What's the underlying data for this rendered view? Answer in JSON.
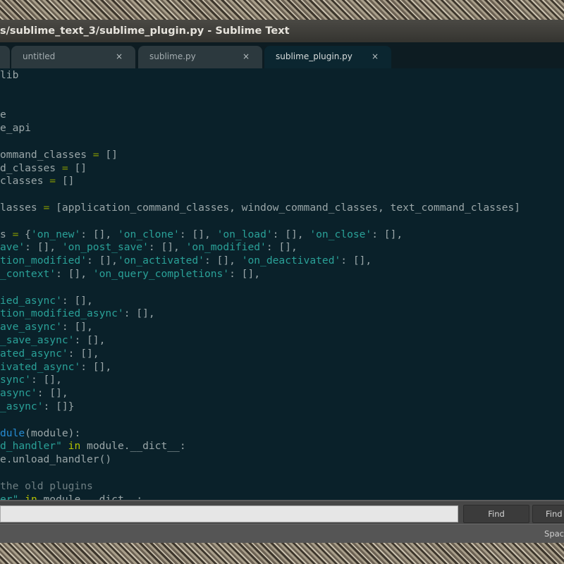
{
  "window": {
    "title": "s/sublime_text_3/sublime_plugin.py - Sublime Text"
  },
  "tabs": [
    {
      "label": "untitled",
      "close": "×",
      "active": false
    },
    {
      "label": "sublime.py",
      "close": "×",
      "active": false
    },
    {
      "label": "sublime_plugin.py",
      "close": "×",
      "active": true
    }
  ],
  "colors": {
    "editor_bg": "#0a212a",
    "string": "#2aa198",
    "operator": "#859900",
    "function": "#268bd2"
  },
  "code_lines": [
    [
      [
        "pl",
        "lib"
      ]
    ],
    [],
    [],
    [
      [
        "pl",
        "e"
      ]
    ],
    [
      [
        "pl",
        "e_api"
      ]
    ],
    [],
    [
      [
        "pl",
        "ommand_classes "
      ],
      [
        "op",
        "="
      ],
      [
        "pl",
        " []"
      ]
    ],
    [
      [
        "pl",
        "d_classes "
      ],
      [
        "op",
        "="
      ],
      [
        "pl",
        " []"
      ]
    ],
    [
      [
        "pl",
        "classes "
      ],
      [
        "op",
        "="
      ],
      [
        "pl",
        " []"
      ]
    ],
    [],
    [
      [
        "pl",
        "lasses "
      ],
      [
        "op",
        "="
      ],
      [
        "pl",
        " [application_command_classes, window_command_classes, text_command_classes]"
      ]
    ],
    [],
    [
      [
        "pl",
        "s "
      ],
      [
        "op",
        "="
      ],
      [
        "pl",
        " {"
      ],
      [
        "str",
        "'on_new'"
      ],
      [
        "pl",
        ": [], "
      ],
      [
        "str",
        "'on_clone'"
      ],
      [
        "pl",
        ": [], "
      ],
      [
        "str",
        "'on_load'"
      ],
      [
        "pl",
        ": [], "
      ],
      [
        "str",
        "'on_close'"
      ],
      [
        "pl",
        ": [],"
      ]
    ],
    [
      [
        "str",
        "ave'"
      ],
      [
        "pl",
        ": [], "
      ],
      [
        "str",
        "'on_post_save'"
      ],
      [
        "pl",
        ": [], "
      ],
      [
        "str",
        "'on_modified'"
      ],
      [
        "pl",
        ": [],"
      ]
    ],
    [
      [
        "str",
        "tion_modified'"
      ],
      [
        "pl",
        ": [],"
      ],
      [
        "str",
        "'on_activated'"
      ],
      [
        "pl",
        ": [], "
      ],
      [
        "str",
        "'on_deactivated'"
      ],
      [
        "pl",
        ": [],"
      ]
    ],
    [
      [
        "str",
        "_context'"
      ],
      [
        "pl",
        ": [], "
      ],
      [
        "str",
        "'on_query_completions'"
      ],
      [
        "pl",
        ": [],"
      ]
    ],
    [],
    [
      [
        "str",
        "ied_async'"
      ],
      [
        "pl",
        ": [],"
      ]
    ],
    [
      [
        "str",
        "tion_modified_async'"
      ],
      [
        "pl",
        ": [],"
      ]
    ],
    [
      [
        "str",
        "ave_async'"
      ],
      [
        "pl",
        ": [],"
      ]
    ],
    [
      [
        "str",
        "_save_async'"
      ],
      [
        "pl",
        ": [],"
      ]
    ],
    [
      [
        "str",
        "ated_async'"
      ],
      [
        "pl",
        ": [],"
      ]
    ],
    [
      [
        "str",
        "ivated_async'"
      ],
      [
        "pl",
        ": [],"
      ]
    ],
    [
      [
        "str",
        "sync'"
      ],
      [
        "pl",
        ": [],"
      ]
    ],
    [
      [
        "str",
        "async'"
      ],
      [
        "pl",
        ": [],"
      ]
    ],
    [
      [
        "str",
        "_async'"
      ],
      [
        "pl",
        ": []}"
      ]
    ],
    [],
    [
      [
        "fn",
        "dule"
      ],
      [
        "pl",
        "(module):"
      ]
    ],
    [
      [
        "str",
        "d_handler\""
      ],
      [
        "pl",
        " "
      ],
      [
        "kw",
        "in"
      ],
      [
        "pl",
        " module.__dict__:"
      ]
    ],
    [
      [
        "pl",
        "e.unload_handler()"
      ]
    ],
    [],
    [
      [
        "cm",
        "the old plugins"
      ]
    ],
    [
      [
        "str",
        "er\""
      ],
      [
        "pl",
        " "
      ],
      [
        "kw",
        "in"
      ],
      [
        "pl",
        " module.__dict__:"
      ]
    ]
  ],
  "find_panel": {
    "input_value": "",
    "find_label": "Find",
    "find_all_label": "Find"
  },
  "status_bar": {
    "indent": "Spac"
  }
}
